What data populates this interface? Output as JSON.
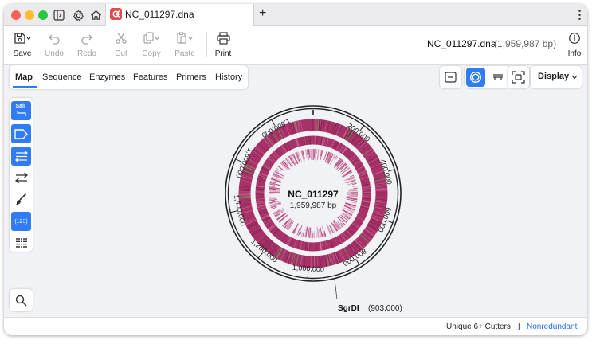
{
  "titlebar": {
    "tab_title": "NC_011297.dna",
    "new_tab": "+",
    "more": "⋮"
  },
  "toolbar": {
    "save": "Save",
    "undo": "Undo",
    "redo": "Redo",
    "cut": "Cut",
    "copy": "Copy",
    "paste": "Paste",
    "print": "Print",
    "filename": "NC_011297.dna",
    "length": "(1,959,987 bp)",
    "info": "Info"
  },
  "view_tabs": [
    "Map",
    "Sequence",
    "Enzymes",
    "Features",
    "Primers",
    "History"
  ],
  "sidebar": {
    "enzyme_label": "SalI",
    "numbers_label": "(123)"
  },
  "display_button": "Display",
  "map": {
    "name": "NC_011297",
    "length": "1,959,987 bp",
    "ticks": [
      "200,000",
      "400,000",
      "600,000",
      "800,000",
      "1,000,000",
      "1,200,000",
      "1,400,000",
      "1,600,000",
      "1,800,000"
    ],
    "site_name": "SgrDI",
    "site_pos": "(903,000)",
    "colors": {
      "feature": "#a83268",
      "inner_feature": "#b3457a",
      "accent": "#2f7cf6"
    }
  },
  "status": {
    "cutters": "Unique 6+ Cutters",
    "separator": "|",
    "mode": "Nonredundant"
  }
}
